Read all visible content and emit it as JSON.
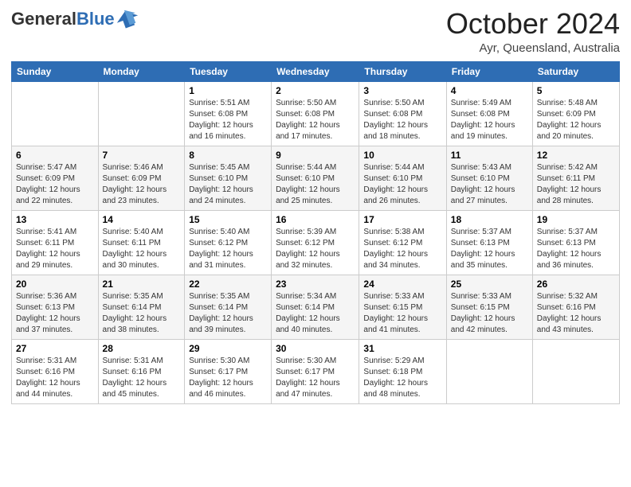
{
  "header": {
    "logo_general": "General",
    "logo_blue": "Blue",
    "month_title": "October 2024",
    "subtitle": "Ayr, Queensland, Australia"
  },
  "days_of_week": [
    "Sunday",
    "Monday",
    "Tuesday",
    "Wednesday",
    "Thursday",
    "Friday",
    "Saturday"
  ],
  "weeks": [
    [
      {
        "day": "",
        "info": ""
      },
      {
        "day": "",
        "info": ""
      },
      {
        "day": "1",
        "info": "Sunrise: 5:51 AM\nSunset: 6:08 PM\nDaylight: 12 hours and 16 minutes."
      },
      {
        "day": "2",
        "info": "Sunrise: 5:50 AM\nSunset: 6:08 PM\nDaylight: 12 hours and 17 minutes."
      },
      {
        "day": "3",
        "info": "Sunrise: 5:50 AM\nSunset: 6:08 PM\nDaylight: 12 hours and 18 minutes."
      },
      {
        "day": "4",
        "info": "Sunrise: 5:49 AM\nSunset: 6:08 PM\nDaylight: 12 hours and 19 minutes."
      },
      {
        "day": "5",
        "info": "Sunrise: 5:48 AM\nSunset: 6:09 PM\nDaylight: 12 hours and 20 minutes."
      }
    ],
    [
      {
        "day": "6",
        "info": "Sunrise: 5:47 AM\nSunset: 6:09 PM\nDaylight: 12 hours and 22 minutes."
      },
      {
        "day": "7",
        "info": "Sunrise: 5:46 AM\nSunset: 6:09 PM\nDaylight: 12 hours and 23 minutes."
      },
      {
        "day": "8",
        "info": "Sunrise: 5:45 AM\nSunset: 6:10 PM\nDaylight: 12 hours and 24 minutes."
      },
      {
        "day": "9",
        "info": "Sunrise: 5:44 AM\nSunset: 6:10 PM\nDaylight: 12 hours and 25 minutes."
      },
      {
        "day": "10",
        "info": "Sunrise: 5:44 AM\nSunset: 6:10 PM\nDaylight: 12 hours and 26 minutes."
      },
      {
        "day": "11",
        "info": "Sunrise: 5:43 AM\nSunset: 6:10 PM\nDaylight: 12 hours and 27 minutes."
      },
      {
        "day": "12",
        "info": "Sunrise: 5:42 AM\nSunset: 6:11 PM\nDaylight: 12 hours and 28 minutes."
      }
    ],
    [
      {
        "day": "13",
        "info": "Sunrise: 5:41 AM\nSunset: 6:11 PM\nDaylight: 12 hours and 29 minutes."
      },
      {
        "day": "14",
        "info": "Sunrise: 5:40 AM\nSunset: 6:11 PM\nDaylight: 12 hours and 30 minutes."
      },
      {
        "day": "15",
        "info": "Sunrise: 5:40 AM\nSunset: 6:12 PM\nDaylight: 12 hours and 31 minutes."
      },
      {
        "day": "16",
        "info": "Sunrise: 5:39 AM\nSunset: 6:12 PM\nDaylight: 12 hours and 32 minutes."
      },
      {
        "day": "17",
        "info": "Sunrise: 5:38 AM\nSunset: 6:12 PM\nDaylight: 12 hours and 34 minutes."
      },
      {
        "day": "18",
        "info": "Sunrise: 5:37 AM\nSunset: 6:13 PM\nDaylight: 12 hours and 35 minutes."
      },
      {
        "day": "19",
        "info": "Sunrise: 5:37 AM\nSunset: 6:13 PM\nDaylight: 12 hours and 36 minutes."
      }
    ],
    [
      {
        "day": "20",
        "info": "Sunrise: 5:36 AM\nSunset: 6:13 PM\nDaylight: 12 hours and 37 minutes."
      },
      {
        "day": "21",
        "info": "Sunrise: 5:35 AM\nSunset: 6:14 PM\nDaylight: 12 hours and 38 minutes."
      },
      {
        "day": "22",
        "info": "Sunrise: 5:35 AM\nSunset: 6:14 PM\nDaylight: 12 hours and 39 minutes."
      },
      {
        "day": "23",
        "info": "Sunrise: 5:34 AM\nSunset: 6:14 PM\nDaylight: 12 hours and 40 minutes."
      },
      {
        "day": "24",
        "info": "Sunrise: 5:33 AM\nSunset: 6:15 PM\nDaylight: 12 hours and 41 minutes."
      },
      {
        "day": "25",
        "info": "Sunrise: 5:33 AM\nSunset: 6:15 PM\nDaylight: 12 hours and 42 minutes."
      },
      {
        "day": "26",
        "info": "Sunrise: 5:32 AM\nSunset: 6:16 PM\nDaylight: 12 hours and 43 minutes."
      }
    ],
    [
      {
        "day": "27",
        "info": "Sunrise: 5:31 AM\nSunset: 6:16 PM\nDaylight: 12 hours and 44 minutes."
      },
      {
        "day": "28",
        "info": "Sunrise: 5:31 AM\nSunset: 6:16 PM\nDaylight: 12 hours and 45 minutes."
      },
      {
        "day": "29",
        "info": "Sunrise: 5:30 AM\nSunset: 6:17 PM\nDaylight: 12 hours and 46 minutes."
      },
      {
        "day": "30",
        "info": "Sunrise: 5:30 AM\nSunset: 6:17 PM\nDaylight: 12 hours and 47 minutes."
      },
      {
        "day": "31",
        "info": "Sunrise: 5:29 AM\nSunset: 6:18 PM\nDaylight: 12 hours and 48 minutes."
      },
      {
        "day": "",
        "info": ""
      },
      {
        "day": "",
        "info": ""
      }
    ]
  ]
}
